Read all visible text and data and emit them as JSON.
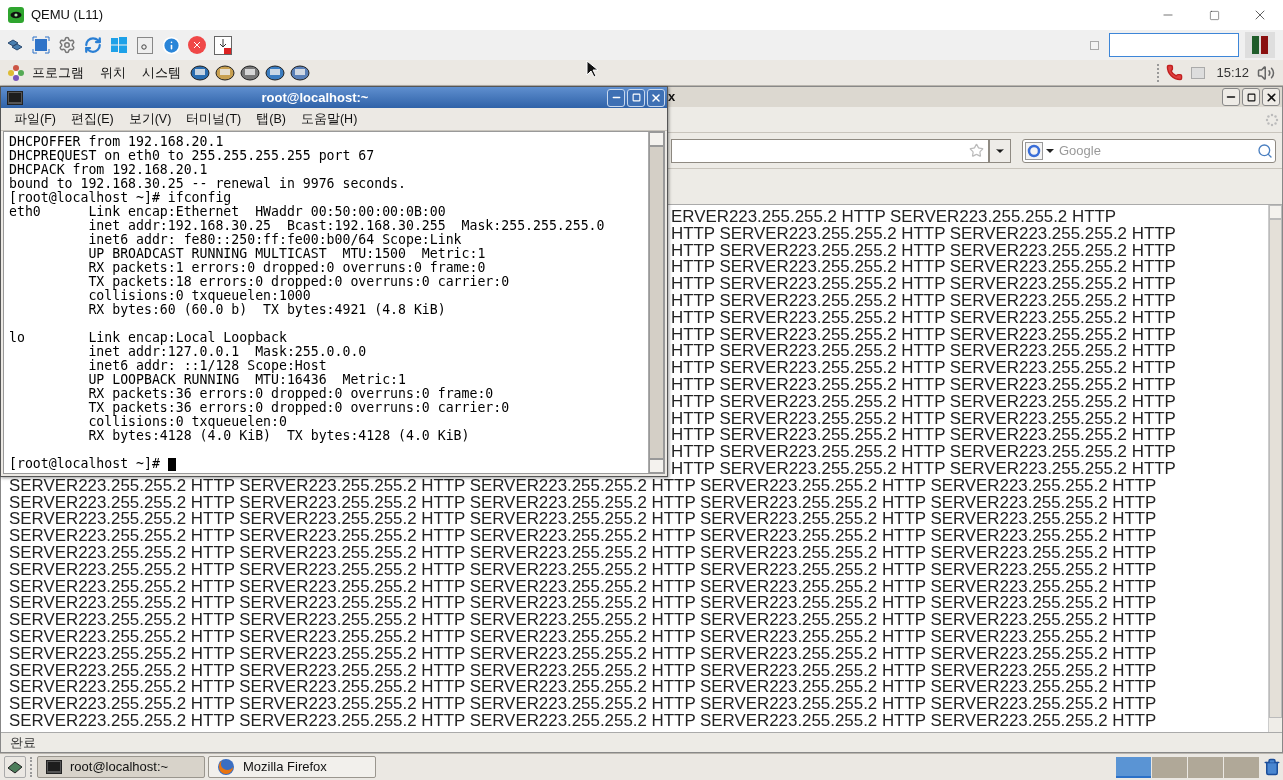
{
  "qemu": {
    "title": "QEMU (L11)",
    "toolbar_checkbox": {
      "checked": false
    }
  },
  "guest_panel": {
    "menus": [
      "프로그램",
      "위치",
      "시스템"
    ],
    "clock": "15:12"
  },
  "terminal": {
    "title": "root@localhost:~",
    "menus": [
      "파일(F)",
      "편집(E)",
      "보기(V)",
      "터미널(T)",
      "탭(B)",
      "도움말(H)"
    ],
    "blocks": [
      [
        "DHCPOFFER from 192.168.20.1",
        "DHCPREQUEST on eth0 to 255.255.255.255 port 67",
        "DHCPACK from 192.168.20.1",
        "bound to 192.168.30.25 -- renewal in 9976 seconds.",
        "[root@localhost ~]# ifconfig",
        "eth0      Link encap:Ethernet  HWaddr 00:50:00:00:0B:00",
        "          inet addr:192.168.30.25  Bcast:192.168.30.255  Mask:255.255.255.0",
        "          inet6 addr: fe80::250:ff:fe00:b00/64 Scope:Link",
        "          UP BROADCAST RUNNING MULTICAST  MTU:1500  Metric:1",
        "          RX packets:1 errors:0 dropped:0 overruns:0 frame:0",
        "          TX packets:18 errors:0 dropped:0 overruns:0 carrier:0",
        "          collisions:0 txqueuelen:1000",
        "          RX bytes:60 (60.0 b)  TX bytes:4921 (4.8 KiB)"
      ],
      [
        "lo        Link encap:Local Loopback",
        "          inet addr:127.0.0.1  Mask:255.0.0.0",
        "          inet6 addr: ::1/128 Scope:Host",
        "          UP LOOPBACK RUNNING  MTU:16436  Metric:1",
        "          RX packets:36 errors:0 dropped:0 overruns:0 frame:0",
        "          TX packets:36 errors:0 dropped:0 overruns:0 carrier:0",
        "          collisions:0 txqueuelen:0",
        "          RX bytes:4128 (4.0 KiB)  TX bytes:4128 (4.0 KiB)"
      ],
      [
        "[root@localhost ~]#"
      ]
    ]
  },
  "firefox": {
    "title": "x",
    "search_placeholder": "Google",
    "status": "완료",
    "rows": [
      {
        "kind": "behind",
        "text": "ERVER223.255.255.2 HTTP SERVER223.255.255.2 HTTP"
      },
      {
        "kind": "behind",
        "text": "HTTP SERVER223.255.255.2 HTTP SERVER223.255.255.2 HTTP"
      },
      {
        "kind": "behind",
        "text": "HTTP SERVER223.255.255.2 HTTP SERVER223.255.255.2 HTTP"
      },
      {
        "kind": "behind",
        "text": "HTTP SERVER223.255.255.2 HTTP SERVER223.255.255.2 HTTP"
      },
      {
        "kind": "behind",
        "text": "HTTP SERVER223.255.255.2 HTTP SERVER223.255.255.2 HTTP"
      },
      {
        "kind": "behind",
        "text": "HTTP SERVER223.255.255.2 HTTP SERVER223.255.255.2 HTTP"
      },
      {
        "kind": "behind",
        "text": "HTTP SERVER223.255.255.2 HTTP SERVER223.255.255.2 HTTP"
      },
      {
        "kind": "behind",
        "text": "HTTP SERVER223.255.255.2 HTTP SERVER223.255.255.2 HTTP"
      },
      {
        "kind": "behind",
        "text": "HTTP SERVER223.255.255.2 HTTP SERVER223.255.255.2 HTTP"
      },
      {
        "kind": "behind",
        "text": "HTTP SERVER223.255.255.2 HTTP SERVER223.255.255.2 HTTP"
      },
      {
        "kind": "behind",
        "text": "HTTP SERVER223.255.255.2 HTTP SERVER223.255.255.2 HTTP"
      },
      {
        "kind": "behind",
        "text": "HTTP SERVER223.255.255.2 HTTP SERVER223.255.255.2 HTTP"
      },
      {
        "kind": "behind",
        "text": "HTTP SERVER223.255.255.2 HTTP SERVER223.255.255.2 HTTP"
      },
      {
        "kind": "behind",
        "text": "HTTP SERVER223.255.255.2 HTTP SERVER223.255.255.2 HTTP"
      },
      {
        "kind": "behind",
        "text": "HTTP SERVER223.255.255.2 HTTP SERVER223.255.255.2 HTTP"
      },
      {
        "kind": "behind",
        "text": "HTTP SERVER223.255.255.2 HTTP SERVER223.255.255.2 HTTP"
      },
      {
        "kind": "full",
        "text": "SERVER223.255.255.2 HTTP SERVER223.255.255.2 HTTP SERVER223.255.255.2 HTTP SERVER223.255.255.2 HTTP SERVER223.255.255.2 HTTP"
      },
      {
        "kind": "full",
        "text": "SERVER223.255.255.2 HTTP SERVER223.255.255.2 HTTP SERVER223.255.255.2 HTTP SERVER223.255.255.2 HTTP SERVER223.255.255.2 HTTP"
      },
      {
        "kind": "full",
        "text": "SERVER223.255.255.2 HTTP SERVER223.255.255.2 HTTP SERVER223.255.255.2 HTTP SERVER223.255.255.2 HTTP SERVER223.255.255.2 HTTP"
      },
      {
        "kind": "full",
        "text": "SERVER223.255.255.2 HTTP SERVER223.255.255.2 HTTP SERVER223.255.255.2 HTTP SERVER223.255.255.2 HTTP SERVER223.255.255.2 HTTP"
      },
      {
        "kind": "full",
        "text": "SERVER223.255.255.2 HTTP SERVER223.255.255.2 HTTP SERVER223.255.255.2 HTTP SERVER223.255.255.2 HTTP SERVER223.255.255.2 HTTP"
      },
      {
        "kind": "full",
        "text": "SERVER223.255.255.2 HTTP SERVER223.255.255.2 HTTP SERVER223.255.255.2 HTTP SERVER223.255.255.2 HTTP SERVER223.255.255.2 HTTP"
      },
      {
        "kind": "full",
        "text": "SERVER223.255.255.2 HTTP SERVER223.255.255.2 HTTP SERVER223.255.255.2 HTTP SERVER223.255.255.2 HTTP SERVER223.255.255.2 HTTP"
      },
      {
        "kind": "full",
        "text": "SERVER223.255.255.2 HTTP SERVER223.255.255.2 HTTP SERVER223.255.255.2 HTTP SERVER223.255.255.2 HTTP SERVER223.255.255.2 HTTP"
      },
      {
        "kind": "full",
        "text": "SERVER223.255.255.2 HTTP SERVER223.255.255.2 HTTP SERVER223.255.255.2 HTTP SERVER223.255.255.2 HTTP SERVER223.255.255.2 HTTP"
      },
      {
        "kind": "full",
        "text": "SERVER223.255.255.2 HTTP SERVER223.255.255.2 HTTP SERVER223.255.255.2 HTTP SERVER223.255.255.2 HTTP SERVER223.255.255.2 HTTP"
      },
      {
        "kind": "full",
        "text": "SERVER223.255.255.2 HTTP SERVER223.255.255.2 HTTP SERVER223.255.255.2 HTTP SERVER223.255.255.2 HTTP SERVER223.255.255.2 HTTP"
      },
      {
        "kind": "full",
        "text": "SERVER223.255.255.2 HTTP SERVER223.255.255.2 HTTP SERVER223.255.255.2 HTTP SERVER223.255.255.2 HTTP SERVER223.255.255.2 HTTP"
      },
      {
        "kind": "full",
        "text": "SERVER223.255.255.2 HTTP SERVER223.255.255.2 HTTP SERVER223.255.255.2 HTTP SERVER223.255.255.2 HTTP SERVER223.255.255.2 HTTP"
      },
      {
        "kind": "full",
        "text": "SERVER223.255.255.2 HTTP SERVER223.255.255.2 HTTP SERVER223.255.255.2 HTTP SERVER223.255.255.2 HTTP SERVER223.255.255.2 HTTP"
      },
      {
        "kind": "full",
        "text": "SERVER223.255.255.2 HTTP SERVER223.255.255.2 HTTP SERVER223.255.255.2 HTTP SERVER223.255.255.2 HTTP SERVER223.255.255.2 HTTP"
      }
    ]
  },
  "taskbar": {
    "tasks": [
      {
        "kind": "terminal",
        "label": "root@localhost:~",
        "selected": true
      },
      {
        "kind": "browser",
        "label": "Mozilla Firefox",
        "selected": false
      }
    ],
    "workspaces": [
      {
        "selected": true
      },
      {
        "selected": false
      },
      {
        "selected": false
      },
      {
        "selected": false
      }
    ]
  }
}
